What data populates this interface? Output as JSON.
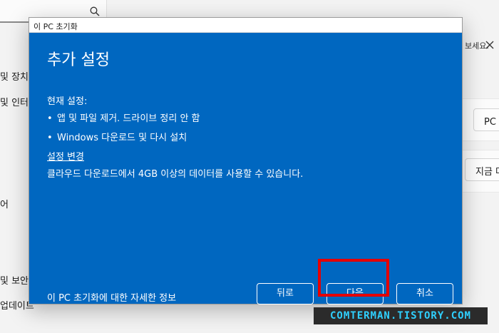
{
  "background": {
    "nav_items": [
      "및 장치",
      "및 인터넷",
      "어",
      "및 보안",
      "업데이트"
    ],
    "hint_text": "보세요.",
    "buttons": [
      "PC 초기화",
      "지금 다시 시작"
    ]
  },
  "dialog": {
    "title": "이 PC 초기화",
    "heading": "추가 설정",
    "current_label": "현재 설정:",
    "settings": [
      "앱 및 파일 제거. 드라이브 정리 안 함",
      "Windows 다운로드 및 다시 설치"
    ],
    "change_link": "설정 변경",
    "info_text": "클라우드 다운로드에서 4GB 이상의 데이터를 사용할 수 있습니다.",
    "more_info_link": "이 PC 초기화에 대한 자세한 정보",
    "back_button": "뒤로",
    "next_button": "다음",
    "cancel_button": "취소"
  },
  "watermark": "COMTERMAN.TISTORY.COM",
  "colors": {
    "dialog_bg": "#0067c0",
    "highlight": "#e50000",
    "watermark_text": "#2fd0ff"
  },
  "icons": {
    "search": "search-icon",
    "close": "close-icon"
  }
}
